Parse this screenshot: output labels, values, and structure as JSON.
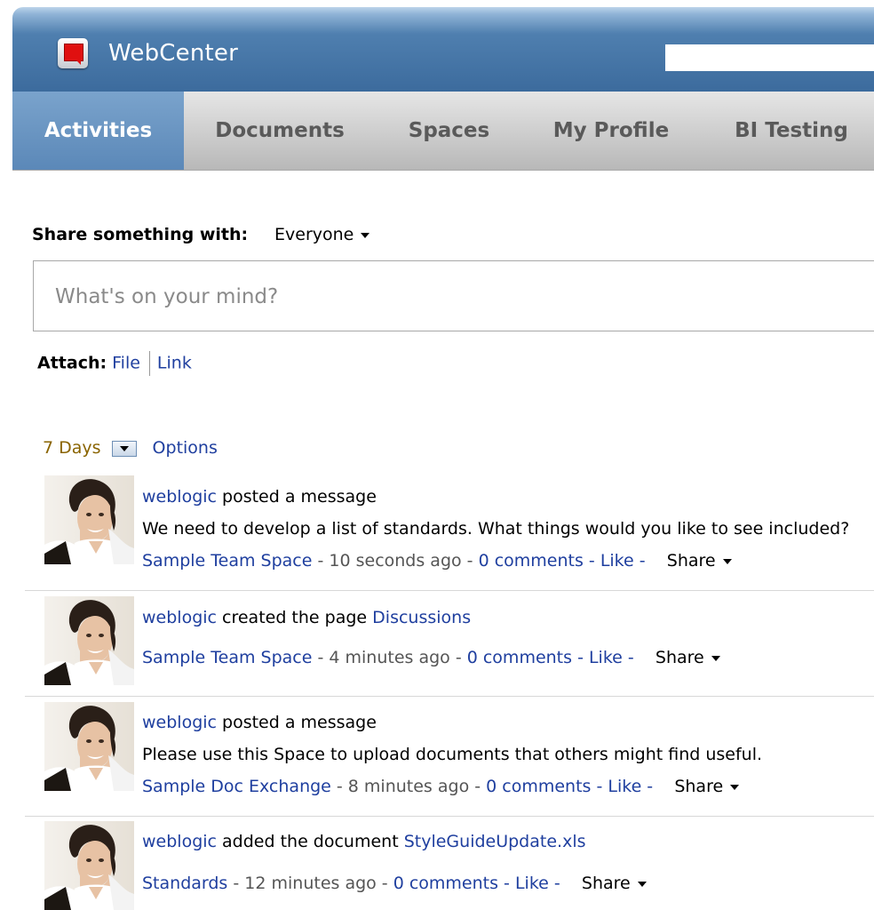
{
  "header": {
    "app_title": "WebCenter",
    "logo_icon": "webcenter-logo-icon",
    "search": {
      "value": "",
      "placeholder": ""
    }
  },
  "nav": {
    "tabs": [
      {
        "label": "Activities",
        "active": true
      },
      {
        "label": "Documents",
        "active": false
      },
      {
        "label": "Spaces",
        "active": false
      },
      {
        "label": "My Profile",
        "active": false
      },
      {
        "label": "BI Testing",
        "active": false
      }
    ]
  },
  "share": {
    "label": "Share something with:",
    "target": "Everyone",
    "placeholder": "What's on your mind?",
    "attach_label": "Attach:",
    "attach_file": "File",
    "attach_link": "Link"
  },
  "filter": {
    "range": "7 Days",
    "options_label": "Options"
  },
  "activities": [
    {
      "user": "weblogic",
      "action": " posted a message",
      "object": "",
      "message": "We need to develop a list of standards. What things would you like to see included?",
      "space": "Sample Team Space",
      "time": " - 10 seconds ago - ",
      "comments": "0 comments",
      "like": "Like",
      "share": "Share"
    },
    {
      "user": "weblogic",
      "action": " created the page ",
      "object": "Discussions",
      "message": "",
      "space": "Sample Team Space",
      "time": " - 4 minutes ago - ",
      "comments": "0 comments",
      "like": "Like",
      "share": "Share"
    },
    {
      "user": "weblogic",
      "action": " posted a message",
      "object": "",
      "message": "Please use this Space to upload documents that others might find useful.",
      "space": "Sample Doc Exchange",
      "time": " - 8 minutes ago - ",
      "comments": "0 comments",
      "like": "Like",
      "share": "Share"
    },
    {
      "user": "weblogic",
      "action": " added the document ",
      "object": "StyleGuideUpdate.xls",
      "message": "",
      "space": "Standards",
      "time": " - 12 minutes ago - ",
      "comments": "0 comments",
      "like": "Like",
      "share": "Share"
    }
  ],
  "colors": {
    "header": "#3c6b9d",
    "active_tab": "#5b88b8",
    "link": "#1f3f9f",
    "days": "#8a6400"
  }
}
